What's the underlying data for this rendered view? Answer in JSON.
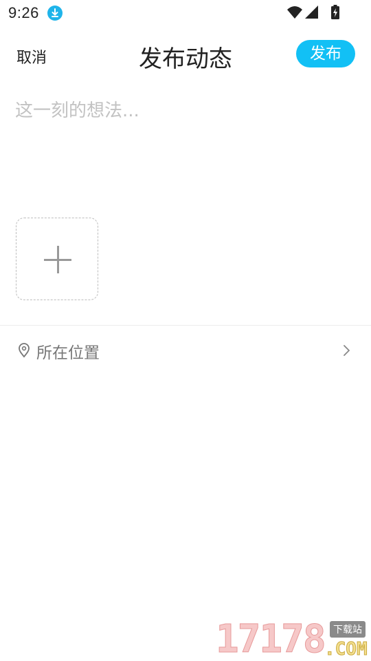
{
  "status_bar": {
    "time": "9:26",
    "download_icon": "download-icon",
    "wifi_icon": "wifi-icon",
    "signal_icon": "signal-icon",
    "battery_icon": "battery-charging-icon",
    "accent_color": "#1fb4ea"
  },
  "header": {
    "cancel_label": "取消",
    "title": "发布动态",
    "publish_label": "发布",
    "publish_color": "#12c0f5"
  },
  "composer": {
    "placeholder": "这一刻的想法...",
    "value": "",
    "add_image_icon": "plus-icon"
  },
  "location": {
    "icon": "location-pin-icon",
    "label": "所在位置",
    "chevron_icon": "chevron-right-icon"
  },
  "watermark": {
    "number": "17178",
    "domain": ".COM",
    "tag": "下载站"
  }
}
